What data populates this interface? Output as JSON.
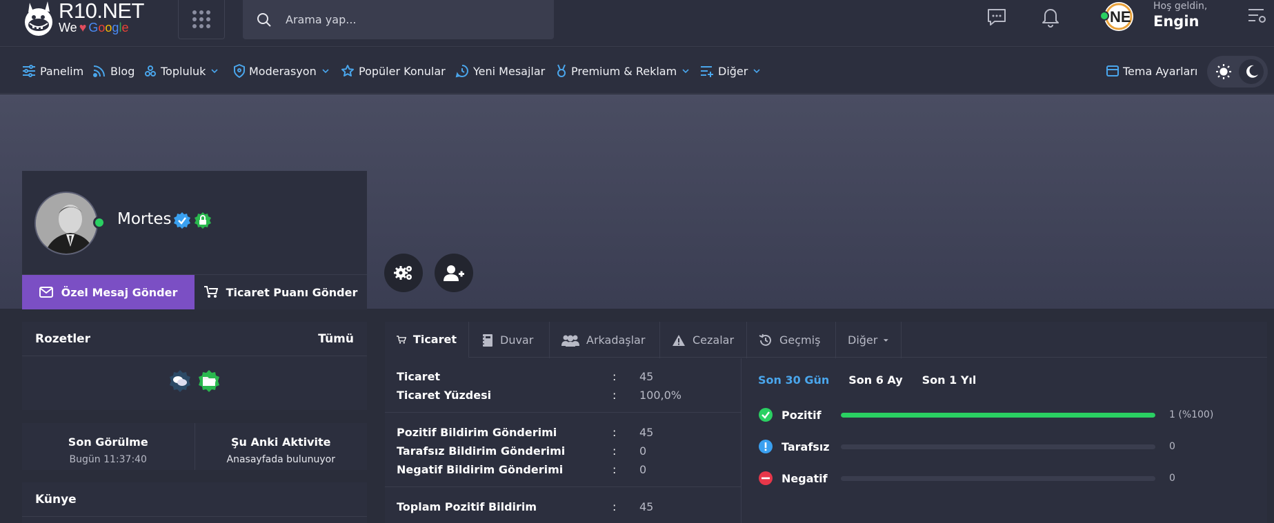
{
  "header": {
    "logo_title": "R10.NET",
    "logo_we": "We",
    "logo_google": [
      "G",
      "o",
      "o",
      "g",
      "l",
      "e"
    ],
    "search_placeholder": "Arama yap...",
    "greeting": "Hoş geldin,",
    "username": "Engin"
  },
  "nav": {
    "items": [
      {
        "label": "Panelim",
        "icon": "sliders-icon",
        "dropdown": false
      },
      {
        "label": "Blog",
        "icon": "rss-icon",
        "dropdown": false
      },
      {
        "label": "Topluluk",
        "icon": "community-icon",
        "dropdown": true
      },
      {
        "label": "Moderasyon",
        "icon": "shield-icon",
        "dropdown": true
      },
      {
        "label": "Popüler Konular",
        "icon": "star-icon",
        "dropdown": false
      },
      {
        "label": "Yeni Mesajlar",
        "icon": "message-clock-icon",
        "dropdown": false
      },
      {
        "label": "Premium & Reklam",
        "icon": "medal-icon",
        "dropdown": true
      },
      {
        "label": "Diğer",
        "icon": "list-plus-icon",
        "dropdown": true
      }
    ],
    "theme_settings": "Tema Ayarları"
  },
  "profile": {
    "name": "Mortes",
    "send_pm": "Özel Mesaj Gönder",
    "send_trade": "Ticaret Puanı Gönder"
  },
  "badges_panel": {
    "title": "Rozetler",
    "all_link": "Tümü"
  },
  "activity": {
    "last_seen_title": "Son Görülme",
    "last_seen_value": "Bugün 11:37:40",
    "current_title": "Şu Anki Aktivite",
    "current_value": "Anasayfada bulunuyor"
  },
  "kunye": {
    "title": "Künye"
  },
  "tabs": [
    {
      "label": "Ticaret",
      "icon": "cart-icon"
    },
    {
      "label": "Duvar",
      "icon": "notebook-icon"
    },
    {
      "label": "Arkadaşlar",
      "icon": "users-icon"
    },
    {
      "label": "Cezalar",
      "icon": "warning-icon"
    },
    {
      "label": "Geçmiş",
      "icon": "history-icon"
    },
    {
      "label": "Diğer",
      "icon": "caret-down-icon"
    }
  ],
  "trade": {
    "rows": [
      {
        "label": "Ticaret",
        "value": "45"
      },
      {
        "label": "Ticaret Yüzdesi",
        "value": "100,0%"
      },
      {
        "label": "Pozitif Bildirim Gönderimi",
        "value": "45"
      },
      {
        "label": "Tarafsız Bildirim Gönderimi",
        "value": "0"
      },
      {
        "label": "Negatif Bildirim Gönderimi",
        "value": "0"
      },
      {
        "label": "Toplam Pozitif Bildirim",
        "value": "45"
      }
    ],
    "colon": ":"
  },
  "periods": [
    "Son 30 Gün",
    "Son 6 Ay",
    "Son 1 Yıl"
  ],
  "ratings": [
    {
      "label": "Pozitif",
      "count": "1 (%100)",
      "fraction": 1.0,
      "color": "#2ad062"
    },
    {
      "label": "Tarafsız",
      "count": "0",
      "fraction": 0,
      "color": "#3aa0f0"
    },
    {
      "label": "Negatif",
      "count": "0",
      "fraction": 0,
      "color": "#e8374a"
    }
  ]
}
